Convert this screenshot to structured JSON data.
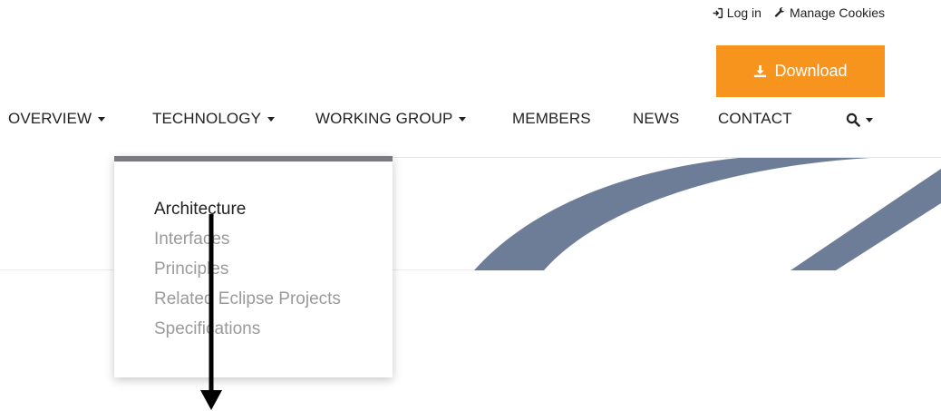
{
  "utility": {
    "login": "Log in",
    "manage_cookies": "Manage Cookies"
  },
  "download": {
    "label": "Download"
  },
  "nav": {
    "items": [
      {
        "label": "OVERVIEW",
        "has_caret": true
      },
      {
        "label": "TECHNOLOGY",
        "has_caret": true
      },
      {
        "label": "WORKING GROUP",
        "has_caret": true
      },
      {
        "label": "MEMBERS",
        "has_caret": false
      },
      {
        "label": "NEWS",
        "has_caret": false
      },
      {
        "label": "CONTACT",
        "has_caret": false
      }
    ],
    "search_icon": "search-icon"
  },
  "technology_dropdown": {
    "items": [
      {
        "label": "Architecture",
        "active": true
      },
      {
        "label": "Interfaces",
        "active": false
      },
      {
        "label": "Principles",
        "active": false
      },
      {
        "label": "Related Eclipse Projects",
        "active": false
      },
      {
        "label": "Specifications",
        "active": false
      }
    ]
  },
  "colors": {
    "accent": "#f7941e",
    "dropdown_border": "#7a7a80",
    "hero_shape": "#6e7d97",
    "inactive_text": "#9a9a9a"
  }
}
